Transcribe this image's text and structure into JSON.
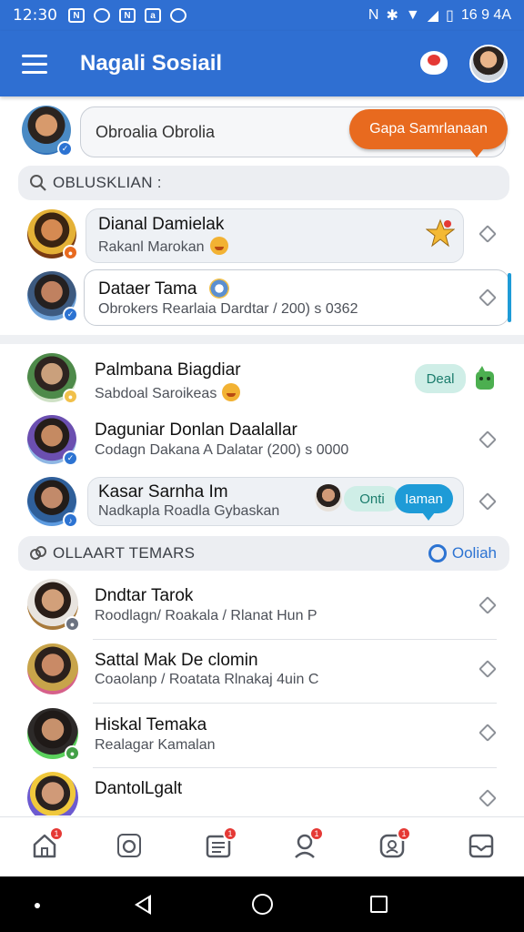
{
  "status_bar": {
    "time": "12:30",
    "right_text": "16 9 4A"
  },
  "app_bar": {
    "title": "Nagali Sosiail"
  },
  "composer": {
    "placeholder": "Obroalia Obrolia",
    "send_label": "Gapa Samrlanaan"
  },
  "search_section": {
    "label": "OBLUSKLIAN :"
  },
  "chats": [
    {
      "name": "Dianal Damielak",
      "subtitle": "Rakanl Marokan"
    },
    {
      "name": "Dataer Tama",
      "subtitle": "Obrokers Rearlaia Dardtar / 200) s 0362"
    },
    {
      "name": "Palmbana Biagdiar",
      "subtitle": "Sabdoal Saroikeas",
      "pill": "Deal"
    },
    {
      "name": "Daguniar Donlan Daalallar",
      "subtitle": "Codagn Dakana A Dalatar (200) s 0000"
    },
    {
      "name": "Kasar Sarnha Im",
      "subtitle": "Nadkapla Roadla Gybaskan",
      "pill_left": "Onti",
      "pill_right": "Iaman"
    }
  ],
  "friends_section": {
    "label": "OLLAART TEMARS",
    "see_all": "Ooliah"
  },
  "friends": [
    {
      "name": "Dndtar Tarok",
      "subtitle": "Roodlagn/ Roakala / Rlanat Hun P"
    },
    {
      "name": "Sattal Mak De clomin",
      "subtitle": "Coaolanp / Roatata Rlnakaj 4uin C"
    },
    {
      "name": "Hiskal Temaka",
      "subtitle": "Realagar Kamalan"
    },
    {
      "name": "DantolLgalt",
      "subtitle": ""
    }
  ],
  "bottom_nav": [
    {
      "icon": "home-icon",
      "badge": "1"
    },
    {
      "icon": "chat-icon",
      "badge": ""
    },
    {
      "icon": "news-icon",
      "badge": "1"
    },
    {
      "icon": "groups-icon",
      "badge": "1"
    },
    {
      "icon": "profile-icon",
      "badge": "1"
    },
    {
      "icon": "inbox-icon",
      "badge": ""
    }
  ],
  "colors": {
    "primary": "#2f6fd2",
    "accent_orange": "#e86a1f",
    "accent_blue": "#1e9bd7"
  }
}
